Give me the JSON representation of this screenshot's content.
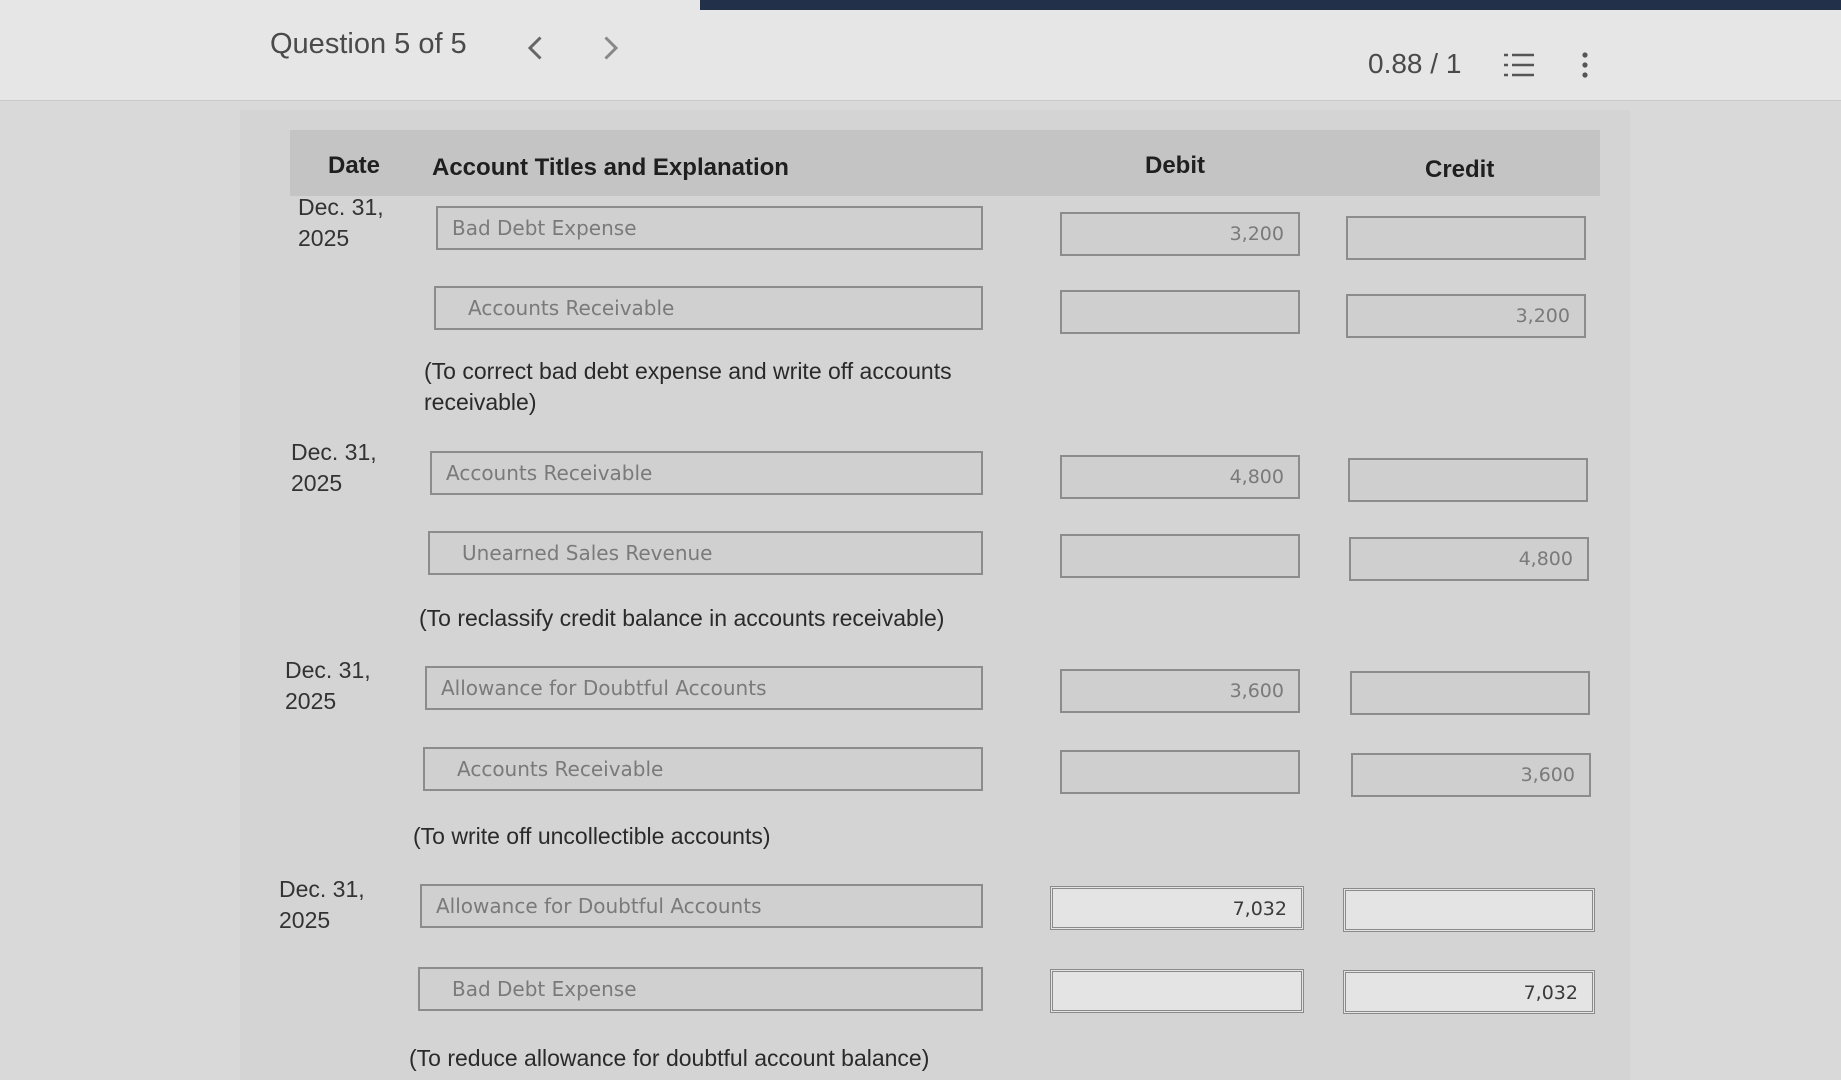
{
  "header": {
    "question_label": "Question 5 of 5",
    "score": "0.88 / 1",
    "icons": [
      "chevron-left-icon",
      "chevron-right-icon",
      "list-icon",
      "more-vertical-icon"
    ]
  },
  "table": {
    "columns": {
      "date": "Date",
      "account": "Account Titles and Explanation",
      "debit": "Debit",
      "credit": "Credit"
    },
    "entries": [
      {
        "date": "Dec. 31,\n2025",
        "rows": [
          {
            "account": "Bad Debt Expense",
            "debit": "3,200",
            "credit": ""
          },
          {
            "account": "Accounts Receivable",
            "debit": "",
            "credit": "3,200"
          }
        ],
        "explanation": "(To correct bad debt expense and write off accounts receivable)"
      },
      {
        "date": "Dec. 31,\n2025",
        "rows": [
          {
            "account": "Accounts Receivable",
            "debit": "4,800",
            "credit": ""
          },
          {
            "account": "Unearned Sales Revenue",
            "debit": "",
            "credit": "4,800"
          }
        ],
        "explanation": "(To reclassify credit balance in accounts receivable)"
      },
      {
        "date": "Dec. 31,\n2025",
        "rows": [
          {
            "account": "Allowance for Doubtful Accounts",
            "debit": "3,600",
            "credit": ""
          },
          {
            "account": "Accounts Receivable",
            "debit": "",
            "credit": "3,600"
          }
        ],
        "explanation": "(To write off uncollectible accounts)"
      },
      {
        "date": "Dec. 31,\n2025",
        "rows": [
          {
            "account": "Allowance for Doubtful Accounts",
            "debit": "7,032",
            "credit": ""
          },
          {
            "account": "Bad Debt Expense",
            "debit": "",
            "credit": "7,032"
          }
        ],
        "explanation": "(To reduce allowance for doubtful account balance)"
      }
    ]
  }
}
